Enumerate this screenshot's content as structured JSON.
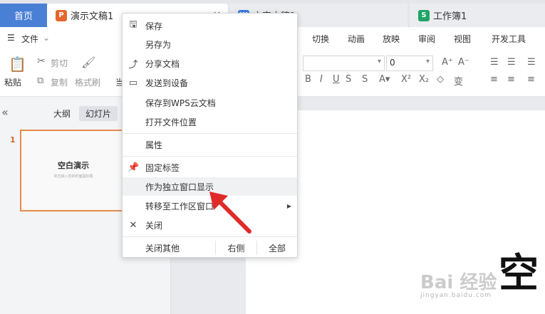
{
  "tabs": {
    "home": "首页",
    "doc1": {
      "icon": "P",
      "title": "演示文稿1",
      "close": "✕",
      "color": "#e5652e"
    },
    "doc2": {
      "icon": "W",
      "title": "文字文稿1",
      "color": "#3d7ce0"
    },
    "doc3": {
      "icon": "S",
      "title": "工作簿1",
      "color": "#21a366"
    }
  },
  "menu": {
    "file": "文件",
    "items": [
      "切换",
      "动画",
      "放映",
      "审阅",
      "视图",
      "开发工具"
    ]
  },
  "ribbon": {
    "paste": "粘贴",
    "cut": "剪切",
    "copy": "复制",
    "format_painter": "格式刷",
    "font_size": "0",
    "font_name": "",
    "partial": "当"
  },
  "left_panel": {
    "outline_tab": "大纲",
    "slides_tab": "幻灯片",
    "slide_number": "1",
    "slide_title": "空白演示",
    "slide_subtitle": "单击输入您的封面副标题"
  },
  "context_menu": {
    "items": [
      {
        "label": "保存",
        "icon": "save-icon"
      },
      {
        "label": "另存为",
        "icon": ""
      },
      {
        "label": "分享文档",
        "icon": "share-icon"
      },
      {
        "label": "发送到设备",
        "icon": "device-icon"
      },
      {
        "label": "保存到WPS云文档",
        "icon": ""
      },
      {
        "label": "打开文件位置",
        "icon": ""
      },
      {
        "label": "属性",
        "icon": ""
      },
      {
        "label": "固定标签",
        "icon": "pin-icon"
      },
      {
        "label": "作为独立窗口显示",
        "icon": ""
      },
      {
        "label": "转移至工作区窗口",
        "icon": ""
      },
      {
        "label": "关闭",
        "icon": "close-icon"
      }
    ],
    "close_others": "关闭其他",
    "right_side": "右侧",
    "all": "全部"
  },
  "watermark": {
    "main": "Bai 经验",
    "sub": "jingyan.baidu.com",
    "overlay_char": "空"
  },
  "colors": {
    "accent": "#4a7fd6",
    "slide_border": "#e58a4e",
    "arrow": "#e02a2a"
  }
}
